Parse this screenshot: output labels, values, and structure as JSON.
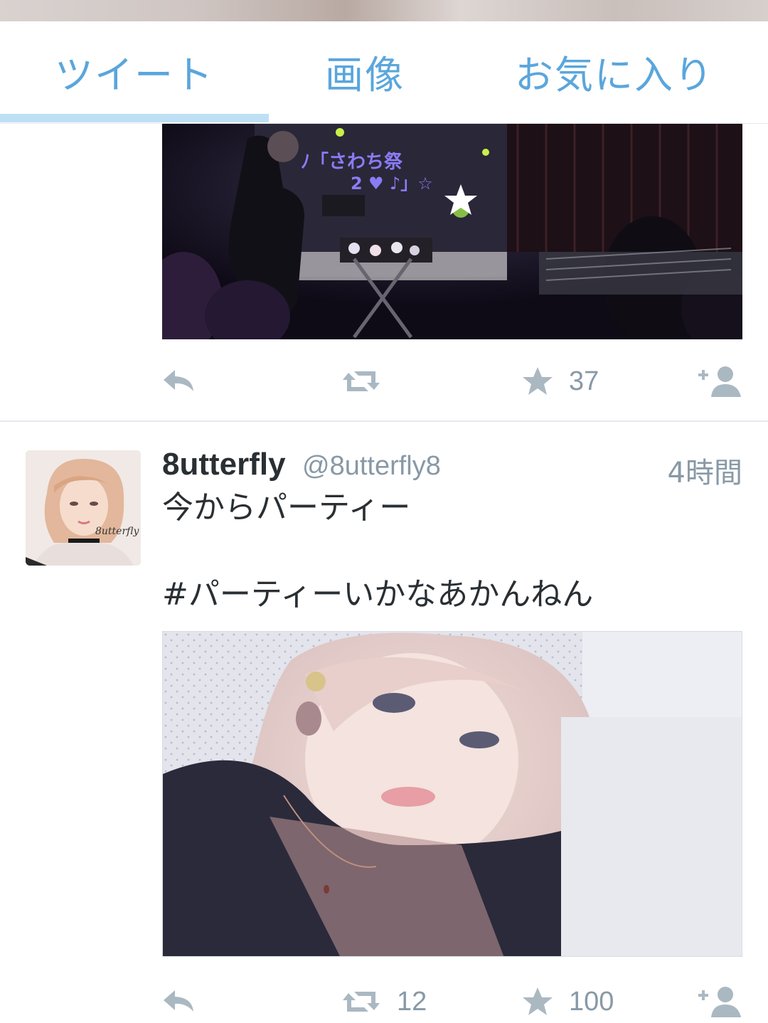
{
  "tabs": [
    {
      "label": "ツイート",
      "active": true
    },
    {
      "label": "画像",
      "active": false
    },
    {
      "label": "お気に入り",
      "active": false
    }
  ],
  "colors": {
    "accent": "#5aa6dc",
    "indicator": "#bfe0f4",
    "icon_gray": "#aab8c2",
    "text": "#292f33",
    "muted": "#8899a6"
  },
  "tweet1": {
    "photo_icon": "event-stage-photo",
    "favorites": "37"
  },
  "tweet2": {
    "name": "8utterfly",
    "handle": "@8utterfly8",
    "time": "4時間",
    "text": "今からパーティー",
    "hashtag": "#パーティーいかなあかんねん",
    "photo_icon": "selfie-photo",
    "avatar_text": "8utterfly",
    "retweets": "12",
    "favorites": "100"
  }
}
